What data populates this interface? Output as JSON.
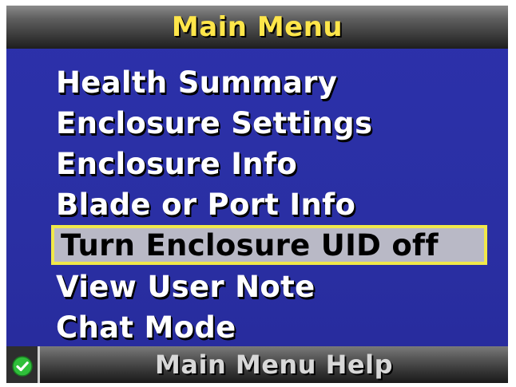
{
  "header": {
    "title": "Main Menu"
  },
  "menu": {
    "items": [
      {
        "label": "Health Summary",
        "selected": false
      },
      {
        "label": "Enclosure Settings",
        "selected": false
      },
      {
        "label": "Enclosure Info",
        "selected": false
      },
      {
        "label": "Blade or Port Info",
        "selected": false
      },
      {
        "label": "Turn Enclosure UID off",
        "selected": true
      },
      {
        "label": "View User Note",
        "selected": false
      },
      {
        "label": "Chat Mode",
        "selected": false
      }
    ]
  },
  "footer": {
    "status_icon": "green-check-circle-icon",
    "help_label": "Main Menu Help"
  },
  "colors": {
    "background": "#2a2fa6",
    "title_text": "#ffe64a",
    "menu_text": "#ffffff",
    "selected_fill": "#b9b9c6",
    "selected_border": "#f0e84a",
    "status_ok": "#2fbf3a"
  }
}
